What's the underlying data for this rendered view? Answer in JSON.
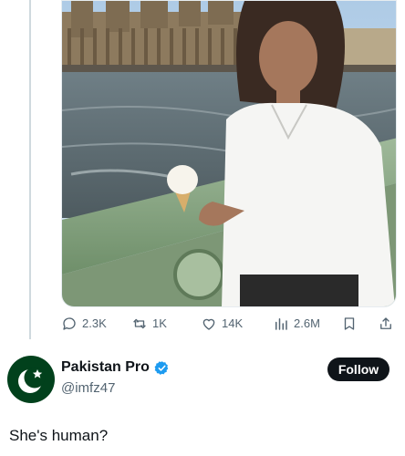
{
  "quoted_post": {
    "actions": {
      "reply_count": "2.3K",
      "repost_count": "1K",
      "like_count": "14K",
      "view_count": "2.6M"
    }
  },
  "author": {
    "display_name": "Pakistan Pro",
    "handle": "@imfz47",
    "avatar_icon": "crescent-star-icon",
    "verified_icon": "verified-badge-icon",
    "follow_label": "Follow"
  },
  "post": {
    "text": "She's human?"
  },
  "colors": {
    "text_primary": "#0f1419",
    "text_secondary": "#536471",
    "verified_blue": "#1d9bf0",
    "flag_green": "#01411c",
    "follow_bg": "#0f1419"
  }
}
